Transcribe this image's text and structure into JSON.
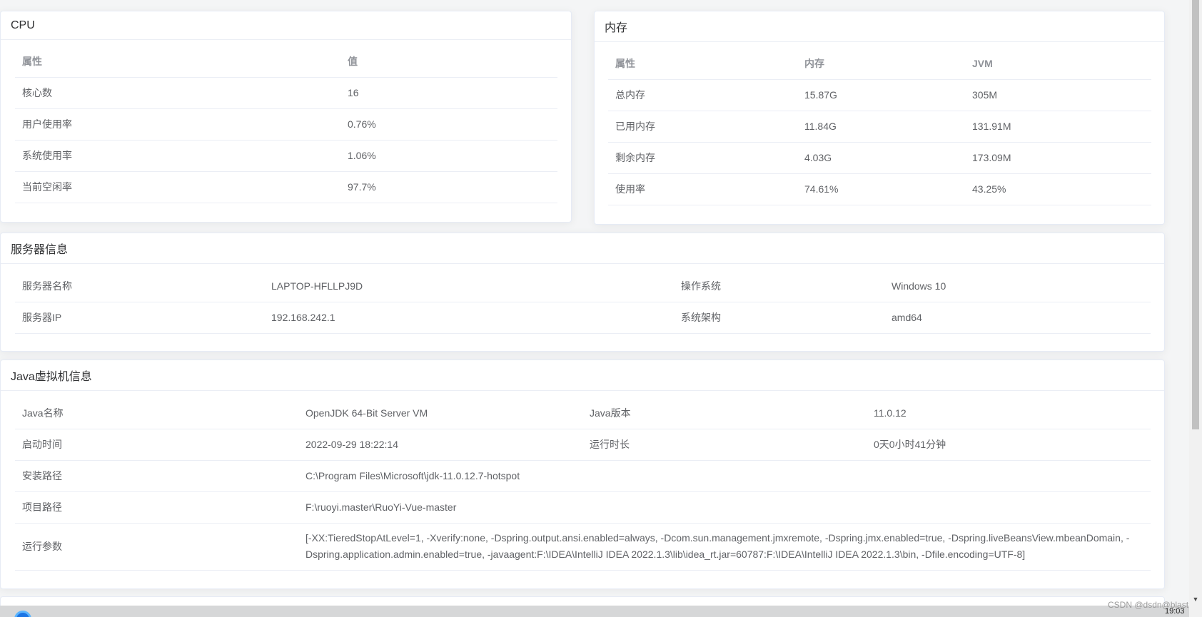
{
  "cpu": {
    "title": "CPU",
    "headers": [
      "属性",
      "值"
    ],
    "rows": [
      [
        "核心数",
        "16"
      ],
      [
        "用户使用率",
        "0.76%"
      ],
      [
        "系统使用率",
        "1.06%"
      ],
      [
        "当前空闲率",
        "97.7%"
      ]
    ]
  },
  "memory": {
    "title": "内存",
    "headers": [
      "属性",
      "内存",
      "JVM"
    ],
    "rows": [
      [
        "总内存",
        "15.87G",
        "305M"
      ],
      [
        "已用内存",
        "11.84G",
        "131.91M"
      ],
      [
        "剩余内存",
        "4.03G",
        "173.09M"
      ],
      [
        "使用率",
        "74.61%",
        "43.25%"
      ]
    ]
  },
  "server": {
    "title": "服务器信息",
    "rows": [
      [
        "服务器名称",
        "LAPTOP-HFLLPJ9D",
        "操作系统",
        "Windows 10"
      ],
      [
        "服务器IP",
        "192.168.242.1",
        "系统架构",
        "amd64"
      ]
    ]
  },
  "jvm": {
    "title": "Java虚拟机信息",
    "rows": [
      [
        "Java名称",
        "OpenJDK 64-Bit Server VM",
        "Java版本",
        "11.0.12"
      ],
      [
        "启动时间",
        "2022-09-29 18:22:14",
        "运行时长",
        "0天0小时41分钟"
      ]
    ],
    "install_path_label": "安装路径",
    "install_path": "C:\\Program Files\\Microsoft\\jdk-11.0.12.7-hotspot",
    "project_path_label": "项目路径",
    "project_path": "F:\\ruoyi.master\\RuoYi-Vue-master",
    "args_label": "运行参数",
    "args": "[-XX:TieredStopAtLevel=1, -Xverify:none, -Dspring.output.ansi.enabled=always, -Dcom.sun.management.jmxremote, -Dspring.jmx.enabled=true, -Dspring.liveBeansView.mbeanDomain, -Dspring.application.admin.enabled=true, -javaagent:F:\\IDEA\\IntelliJ IDEA 2022.1.3\\lib\\idea_rt.jar=60787:F:\\IDEA\\IntelliJ IDEA 2022.1.3\\bin, -Dfile.encoding=UTF-8]"
  },
  "footer": {
    "watermark": "CSDN @dsdn@blast",
    "clock": "19:03"
  },
  "icons": {
    "taskbar": "browser-icon",
    "scroll_down": "▼"
  }
}
